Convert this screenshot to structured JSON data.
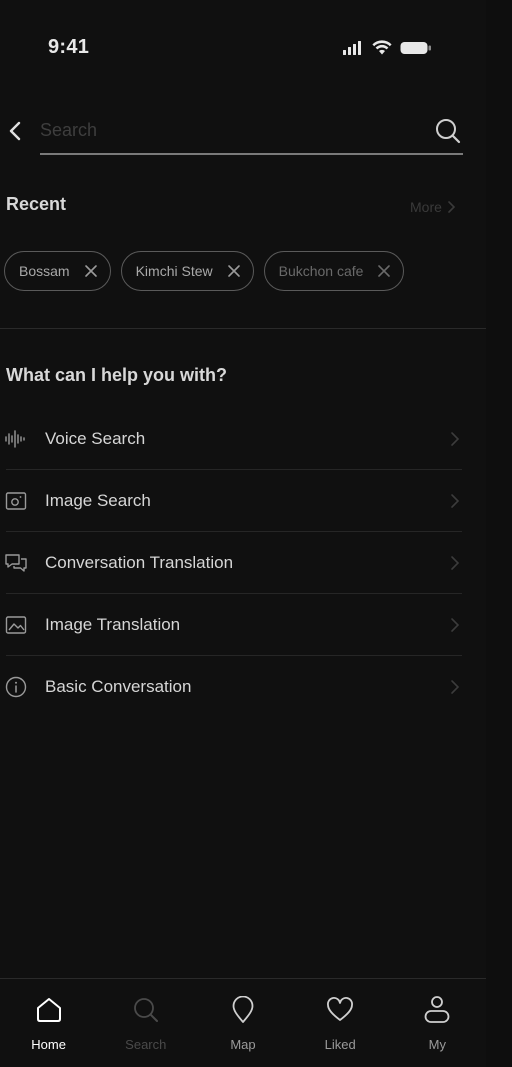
{
  "status_bar": {
    "time": "9:41"
  },
  "search": {
    "placeholder": "Search",
    "value": ""
  },
  "recent": {
    "title": "Recent",
    "more_label": "More",
    "chips": [
      {
        "label": "Bossam"
      },
      {
        "label": "Kimchi Stew"
      },
      {
        "label": "Bukchon cafe"
      }
    ]
  },
  "help": {
    "title": "What can I help you with?",
    "items": [
      {
        "label": "Voice Search",
        "icon": "voice-wave-icon"
      },
      {
        "label": "Image Search",
        "icon": "image-search-icon"
      },
      {
        "label": "Conversation Translation",
        "icon": "chat-bubbles-icon"
      },
      {
        "label": "Image Translation",
        "icon": "image-icon"
      },
      {
        "label": "Basic Conversation",
        "icon": "info-icon"
      }
    ]
  },
  "nav": {
    "items": [
      {
        "label": "Home",
        "icon": "home-icon",
        "active": true
      },
      {
        "label": "Search",
        "icon": "search-icon"
      },
      {
        "label": "Map",
        "icon": "map-pin-icon"
      },
      {
        "label": "Liked",
        "icon": "heart-icon"
      },
      {
        "label": "My",
        "icon": "user-icon"
      }
    ]
  },
  "colors": {
    "background": "#101010",
    "text": "#d6d6d6",
    "muted": "#3e3e3e",
    "active": "#ffffff"
  }
}
